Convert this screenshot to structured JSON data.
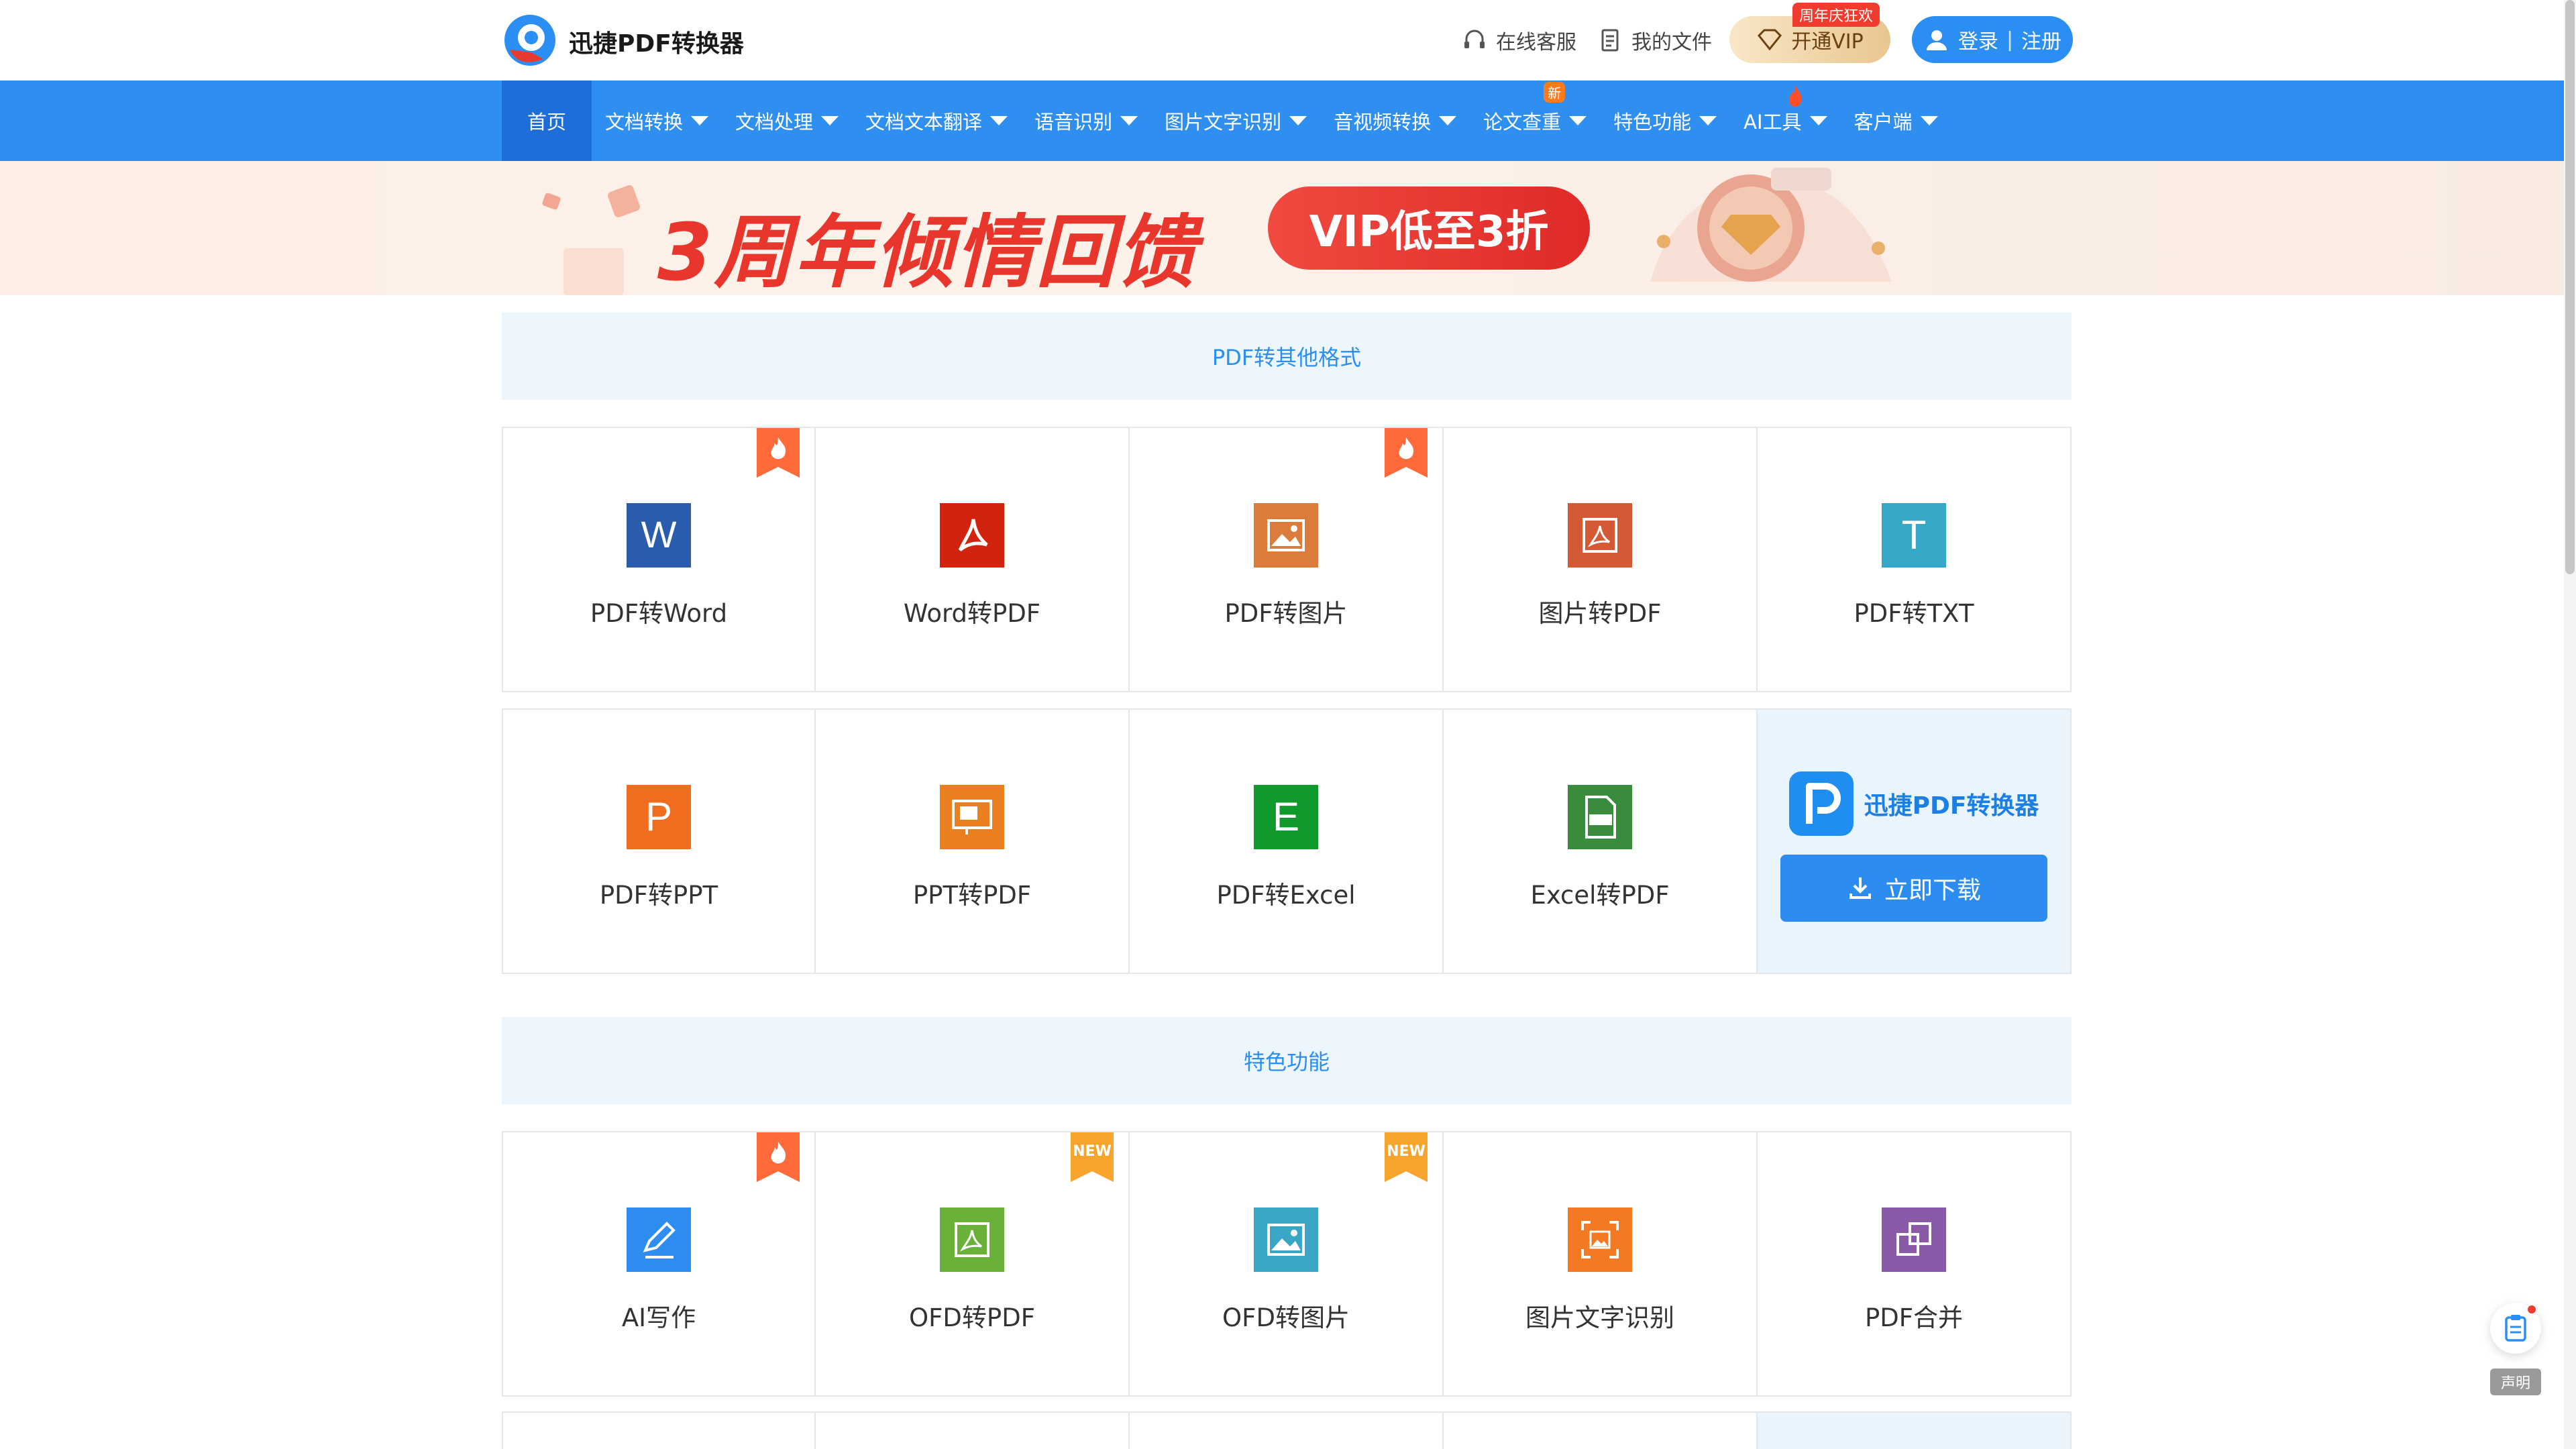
{
  "header": {
    "brand": "迅捷PDF转换器",
    "service": "在线客服",
    "my_files": "我的文件",
    "vip_label": "开通VIP",
    "vip_tag": "周年庆狂欢",
    "login": "登录",
    "register": "注册"
  },
  "nav": {
    "items": [
      {
        "label": "首页"
      },
      {
        "label": "文档转换"
      },
      {
        "label": "文档处理"
      },
      {
        "label": "文档文本翻译"
      },
      {
        "label": "语音识别"
      },
      {
        "label": "图片文字识别"
      },
      {
        "label": "音视频转换"
      },
      {
        "label": "论文查重",
        "badge": "新"
      },
      {
        "label": "特色功能"
      },
      {
        "label": "AI工具"
      },
      {
        "label": "客户端"
      }
    ]
  },
  "banner": {
    "title": "3周年倾情回馈",
    "pill": "VIP低至3折"
  },
  "section1": {
    "title": "PDF转其他格式",
    "row1": [
      "PDF转Word",
      "Word转PDF",
      "PDF转图片",
      "图片转PDF",
      "PDF转TXT"
    ],
    "row2": [
      "PDF转PPT",
      "PPT转PDF",
      "PDF转Excel",
      "Excel转PDF"
    ],
    "download_brand": "迅捷PDF转换器",
    "download_btn": "立即下载"
  },
  "section2": {
    "title": "特色功能",
    "row1": [
      "AI写作",
      "OFD转PDF",
      "OFD转图片",
      "图片文字识别",
      "PDF合并"
    ],
    "new_badge": "NEW"
  },
  "float": {
    "label": "声明"
  },
  "colors": {
    "primary": "#2e8ff0",
    "banner_red": "#e8362d"
  }
}
